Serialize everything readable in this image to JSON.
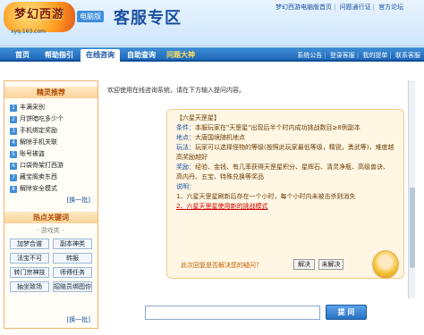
{
  "header": {
    "logo_text": "梦幻西游",
    "logo_url": "xyq.163.com",
    "badge": "电脑版",
    "title": "客服专区",
    "links": [
      "梦幻西游电脑版首页",
      "问题通行证",
      "官方论坛"
    ]
  },
  "nav": {
    "tabs": [
      "首页",
      "帮助指引",
      "在线咨询",
      "自助查询",
      "问题大神"
    ],
    "active_index": 2,
    "right_links": [
      "系统公告",
      "登录客服",
      "我的提单",
      "联系客服"
    ]
  },
  "sidebar": {
    "recommend_title": "精灵推荐",
    "items": [
      "丰满采别",
      "月饼暗吃多少个",
      "手机绑定奖励",
      "解除手机关联",
      "账号被盗",
      "口袋骨架打西游",
      "藏宝阁卖东西",
      "解除安全模式"
    ],
    "swap_label": "[换一批]",
    "hot_title": "热点关键词",
    "hot_sub": "- 游戏类 -",
    "keywords": [
      "加梦合谱",
      "副本神类",
      "法宝不可",
      "转服",
      "转门宗神技",
      "师傅任务",
      "抽坐致场",
      "招赔员绑图你"
    ]
  },
  "main": {
    "welcome": "欢迎使用在线咨询系统，请在下方输入提问内容。",
    "answer": {
      "heading": "【六星天罡星】",
      "lines": [
        {
          "label": "条件：",
          "text": "本服玩家在\"天罡星\"出现后半个时内成功挑战数目≥8例副本"
        },
        {
          "label": "地点：",
          "text": "大唐国境随机地点"
        },
        {
          "label": "玩法：",
          "text": "玩家可以选择怪物的等级(按照此玩家最低等级，精锐，勇武等)，难度越高奖励越好"
        },
        {
          "label": "奖励：",
          "text": "经验、金钱、有几率获得天罡星积分、星辉石、清灵净瓶、高级兽诀、高内丹、五宝、特殊兑换等奖品"
        },
        {
          "label": "说明：",
          "text": ""
        }
      ],
      "notes": [
        "1、六星天罡星刷新后存在一个小时，每个小时内未被击杀则消失",
        "2、六星天罡星使用新的挑战模式"
      ],
      "feedback": "此次回复是否解决您的疑问？",
      "solved": "解决",
      "unsolved": "未解决"
    },
    "input_placeholder": "",
    "ask_label": "提 问"
  }
}
